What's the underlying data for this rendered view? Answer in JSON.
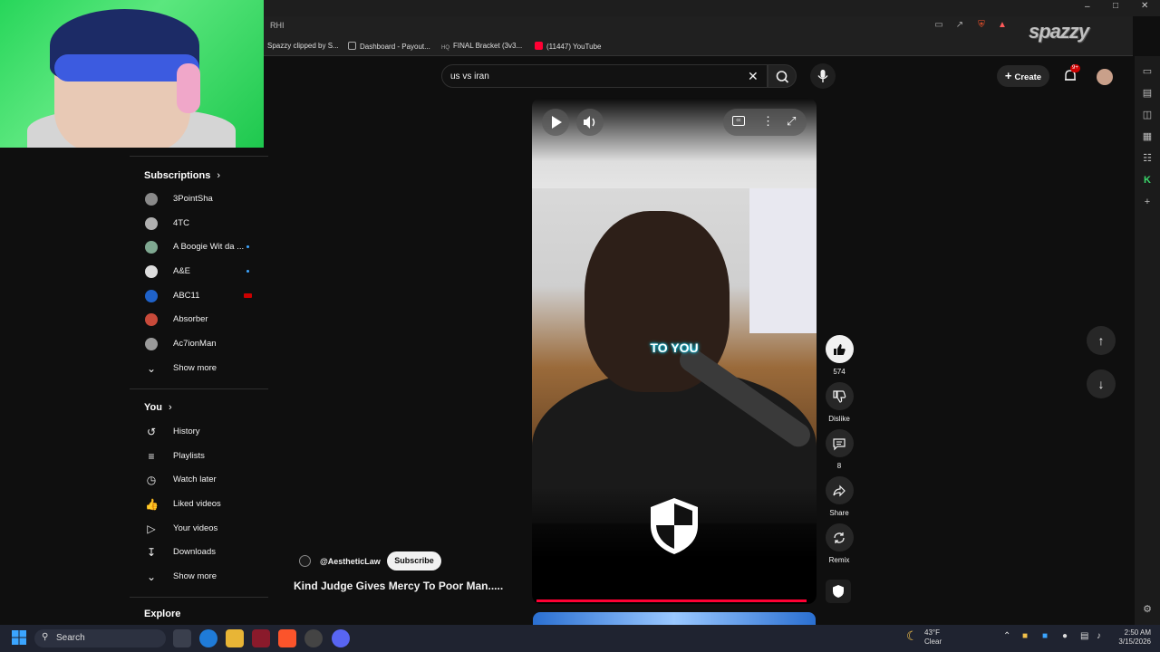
{
  "browser": {
    "tab_text": "RHI",
    "bookmarks": [
      {
        "label": "Spazzy clipped by S...",
        "color": "#6b6bff"
      },
      {
        "label": "Dashboard - Payout...",
        "color": "#888888"
      },
      {
        "label": "FINAL Bracket (3v3...",
        "color": "#aaaaaa"
      },
      {
        "label": "(11447) YouTube",
        "color": "#ff0033"
      }
    ],
    "watermark": "spazzy"
  },
  "search": {
    "query": "us vs iran"
  },
  "header": {
    "create_label": "Create",
    "notification_badge": "9+"
  },
  "sidebar": {
    "subscriptions_heading": "Subscriptions",
    "subscriptions": [
      {
        "label": "3PointSha",
        "color": "#8a8a8a",
        "indicator": "none"
      },
      {
        "label": "4TC",
        "color": "#b0b0b0",
        "indicator": "none"
      },
      {
        "label": "A Boogie Wit da ...",
        "color": "#7fa891",
        "indicator": "dot"
      },
      {
        "label": "A&E",
        "color": "#dddddd",
        "indicator": "dot"
      },
      {
        "label": "ABC11",
        "color": "#1f62c9",
        "indicator": "live"
      },
      {
        "label": "Absorber",
        "color": "#c84a3a",
        "indicator": "none"
      },
      {
        "label": "Ac7ionMan",
        "color": "#9a9a9a",
        "indicator": "none"
      }
    ],
    "show_more_1": "Show more",
    "you_heading": "You",
    "you_items": [
      {
        "label": "History",
        "icon": "history-icon"
      },
      {
        "label": "Playlists",
        "icon": "playlists-icon"
      },
      {
        "label": "Watch later",
        "icon": "clock-icon"
      },
      {
        "label": "Liked videos",
        "icon": "thumbs-up-icon"
      },
      {
        "label": "Your videos",
        "icon": "video-icon"
      },
      {
        "label": "Downloads",
        "icon": "download-icon"
      }
    ],
    "show_more_2": "Show more",
    "explore_heading": "Explore"
  },
  "video": {
    "caption": "TO YOU",
    "channel": "@AestheticLaw",
    "subscribe_label": "Subscribe",
    "title": "Kind Judge Gives Mercy To Poor Man.....",
    "progress_fraction": 0.98
  },
  "actions": {
    "like_count": "574",
    "dislike_label": "Dislike",
    "comment_count": "8",
    "share_label": "Share",
    "remix_label": "Remix"
  },
  "taskbar": {
    "search_label": "Search",
    "temperature": "43°F",
    "weather": "Clear",
    "time": "2:50 AM",
    "date": "3/15/2026"
  }
}
